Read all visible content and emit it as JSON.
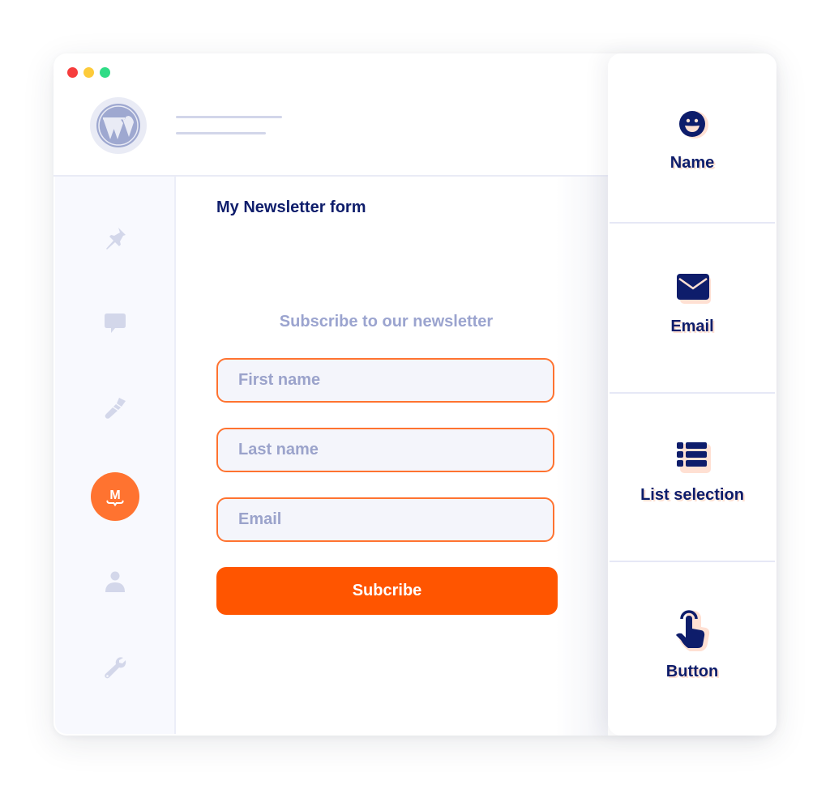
{
  "window": {
    "traffic_lights": [
      {
        "name": "close",
        "color": "#f63d3d"
      },
      {
        "name": "minimize",
        "color": "#fdcb3a"
      },
      {
        "name": "maximize",
        "color": "#2fdc86"
      }
    ]
  },
  "header": {
    "logo": "wordpress-logo"
  },
  "sidebar": {
    "items": [
      {
        "icon": "pin-icon"
      },
      {
        "icon": "comment-icon"
      },
      {
        "icon": "brush-icon"
      },
      {
        "icon": "mailpoet-icon",
        "label": "M",
        "active": true
      },
      {
        "icon": "user-icon"
      },
      {
        "icon": "wrench-icon"
      }
    ]
  },
  "form": {
    "title": "My Newsletter form",
    "subtitle": "Subscribe to our newsletter",
    "fields": [
      {
        "placeholder": "First name"
      },
      {
        "placeholder": "Last name"
      },
      {
        "placeholder": "Email"
      }
    ],
    "submit_label": "Subcribe"
  },
  "blocks_panel": {
    "items": [
      {
        "label": "Name",
        "icon": "smiley-icon"
      },
      {
        "label": "Email",
        "icon": "envelope-icon"
      },
      {
        "label": "List selection",
        "icon": "list-icon"
      },
      {
        "label": "Button",
        "icon": "pointer-hand-icon"
      }
    ]
  },
  "colors": {
    "accent": "#ff5500",
    "field_border": "#ff7330",
    "navy": "#0e1d6b",
    "muted": "#9ba4cf",
    "icon_highlight": "#ffe0d3"
  }
}
